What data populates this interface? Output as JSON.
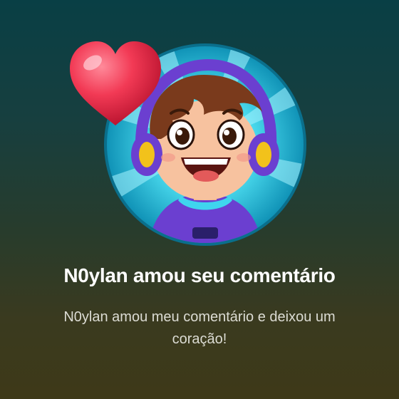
{
  "notification": {
    "title": "N0ylan amou seu comentário",
    "message": "N0ylan amou meu comentário e deixou um coração!"
  },
  "icons": {
    "avatar": "cartoon-boy-with-headphones-avatar",
    "reaction": "heart-icon"
  },
  "colors": {
    "background_top": "#093f45",
    "background_bottom": "#3e3918",
    "avatar_ring": "#1fc7e0",
    "heart": "#e8294a",
    "title_text": "#ffffff",
    "message_text": "#dcdcd4"
  }
}
